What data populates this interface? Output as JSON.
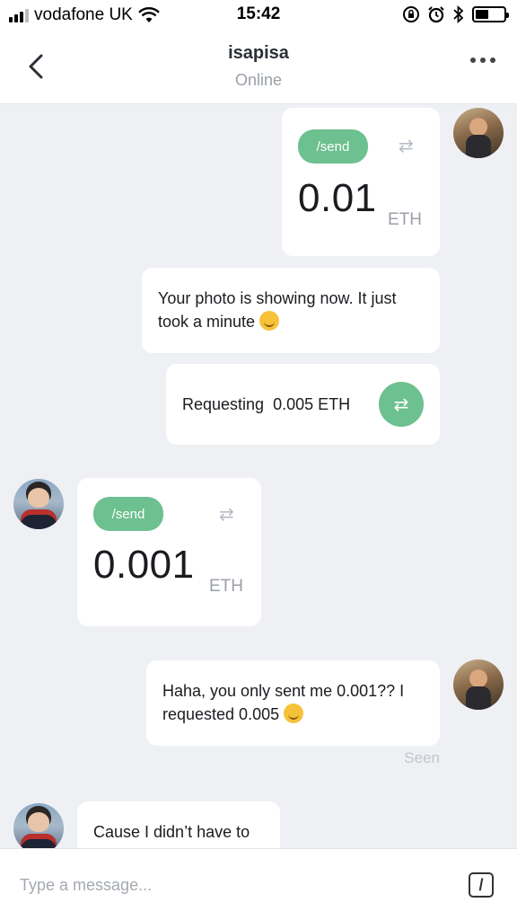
{
  "status_bar": {
    "carrier": "vodafone UK",
    "time": "15:42"
  },
  "header": {
    "title": "isapisa",
    "subtitle": "Online"
  },
  "messages": [
    {
      "type": "payment",
      "side": "outgoing",
      "command": "/send",
      "amount": "0.01",
      "unit": "ETH"
    },
    {
      "type": "text",
      "side": "outgoing",
      "text": "Your photo is showing now. It just took a minute",
      "emoji": "smiling-face"
    },
    {
      "type": "request",
      "side": "outgoing",
      "label": "Requesting",
      "amount": "0.005 ETH"
    },
    {
      "type": "payment",
      "side": "incoming",
      "command": "/send",
      "amount": "0.001",
      "unit": "ETH"
    },
    {
      "type": "text",
      "side": "outgoing",
      "text": "Haha, you only sent me 0.001?? I requested 0.005",
      "emoji": "tears-of-joy"
    },
    {
      "type": "text",
      "side": "incoming",
      "text": "Cause I didn’t have to"
    }
  ],
  "seen_label": "Seen",
  "composer": {
    "placeholder": "Type a message...",
    "command_icon": "/"
  },
  "colors": {
    "accent": "#6dc08f",
    "background": "#eef0f4",
    "bubble": "#ffffff"
  }
}
